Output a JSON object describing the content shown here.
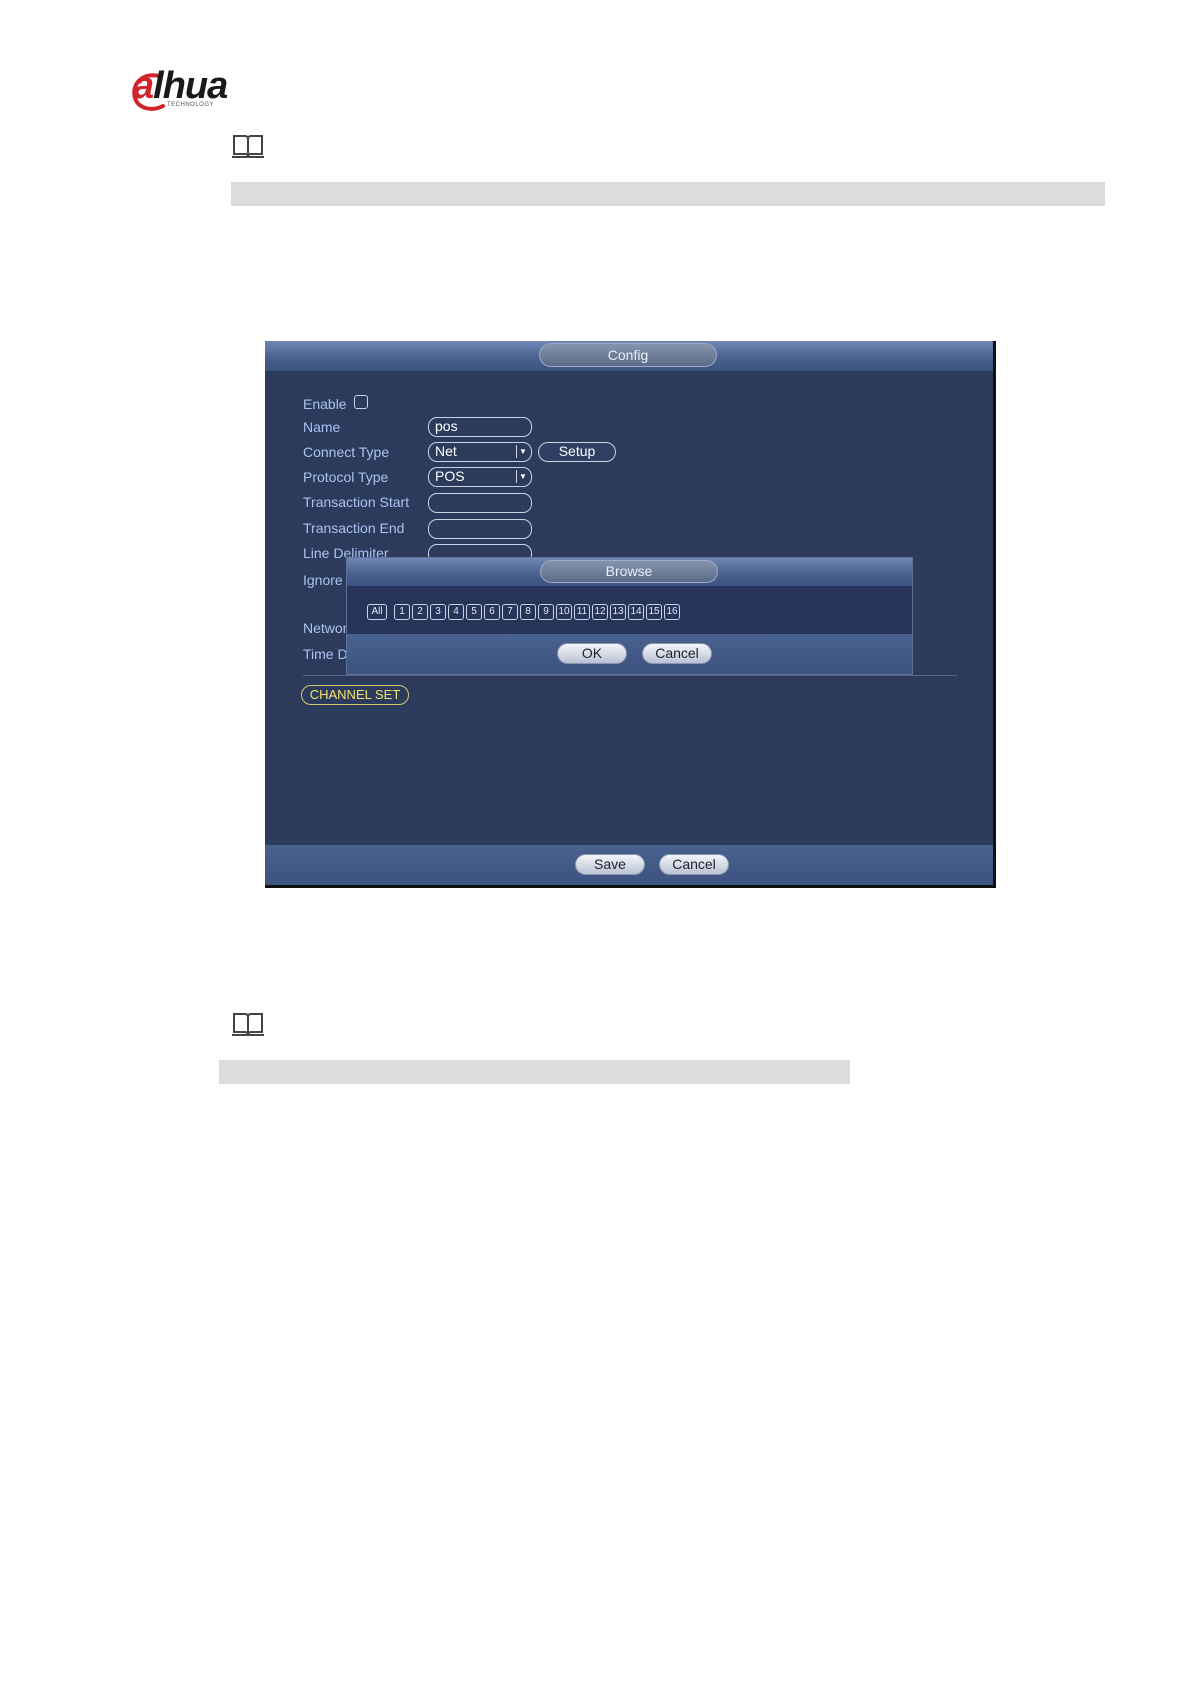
{
  "brand": {
    "name_a": "a",
    "name_rest": "lhua",
    "tagline": "TECHNOLOGY"
  },
  "colors": {
    "brand_red": "#d2232a",
    "dvr_bg": "#2c3a5c",
    "label_blue": "#a9c3f0",
    "channel_yellow": "#f4e36a"
  },
  "icons": {
    "note": "book-note-icon",
    "dropdown": "chevron-down-icon"
  },
  "config": {
    "title": "Config",
    "fields": {
      "enable_label": "Enable",
      "name_label": "Name",
      "name_value": "pos",
      "connect_type_label": "Connect Type",
      "connect_type_value": "Net",
      "setup_label": "Setup",
      "protocol_type_label": "Protocol Type",
      "protocol_type_value": "POS",
      "transaction_start_label": "Transaction Start",
      "transaction_start_value": "",
      "transaction_end_label": "Transaction End",
      "transaction_end_value": "",
      "line_delimiter_label": "Line Delimiter",
      "ignore_label": "Ignore",
      "network_label": "Networ",
      "time_label": "Time D"
    },
    "channel_set_label": "CHANNEL SET",
    "save_label": "Save",
    "cancel_label": "Cancel"
  },
  "browse": {
    "title": "Browse",
    "all_label": "All",
    "channels": [
      "1",
      "2",
      "3",
      "4",
      "5",
      "6",
      "7",
      "8",
      "9",
      "10",
      "11",
      "12",
      "13",
      "14",
      "15",
      "16"
    ],
    "ok_label": "OK",
    "cancel_label": "Cancel"
  }
}
